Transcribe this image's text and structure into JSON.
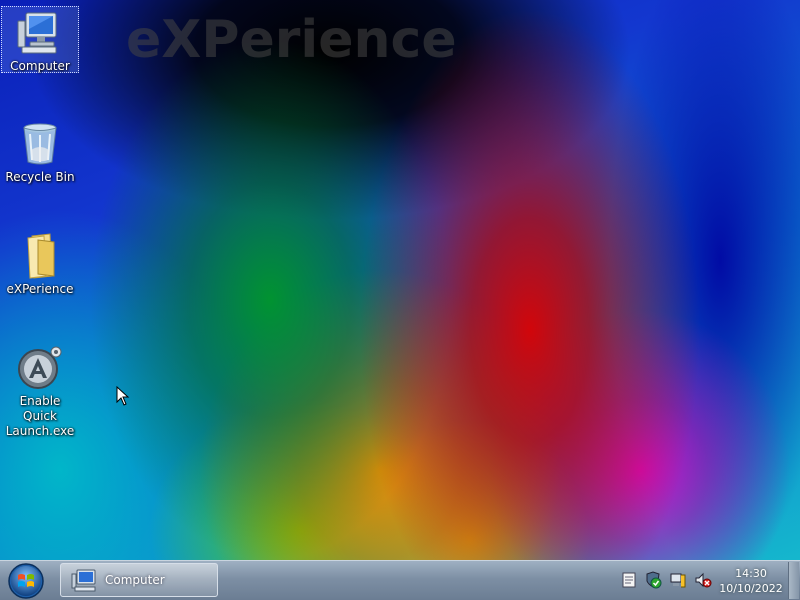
{
  "wallpaper": {
    "brand_text": "eXPerience"
  },
  "desktop_icons": [
    {
      "label": "Computer",
      "icon": "computer-icon",
      "selected": true
    },
    {
      "label": "Recycle Bin",
      "icon": "recycle-bin-icon"
    },
    {
      "label": "eXPerience",
      "icon": "folder-icon"
    },
    {
      "label_line1": "Enable Quick",
      "label_line2": "Launch.exe",
      "icon": "app-launcher-icon"
    }
  ],
  "taskbar": {
    "start_icon": "start-orb-icon",
    "buttons": [
      {
        "label": "Computer",
        "icon": "computer-icon"
      }
    ],
    "tray_icons": [
      "notes-icon",
      "security-shield-icon",
      "network-icon",
      "volume-muted-icon"
    ],
    "clock": {
      "time": "14:30",
      "date": "10/10/2022"
    }
  },
  "colors": {
    "taskbar": "#7d8fa4",
    "desktop_text": "#ffffff"
  }
}
